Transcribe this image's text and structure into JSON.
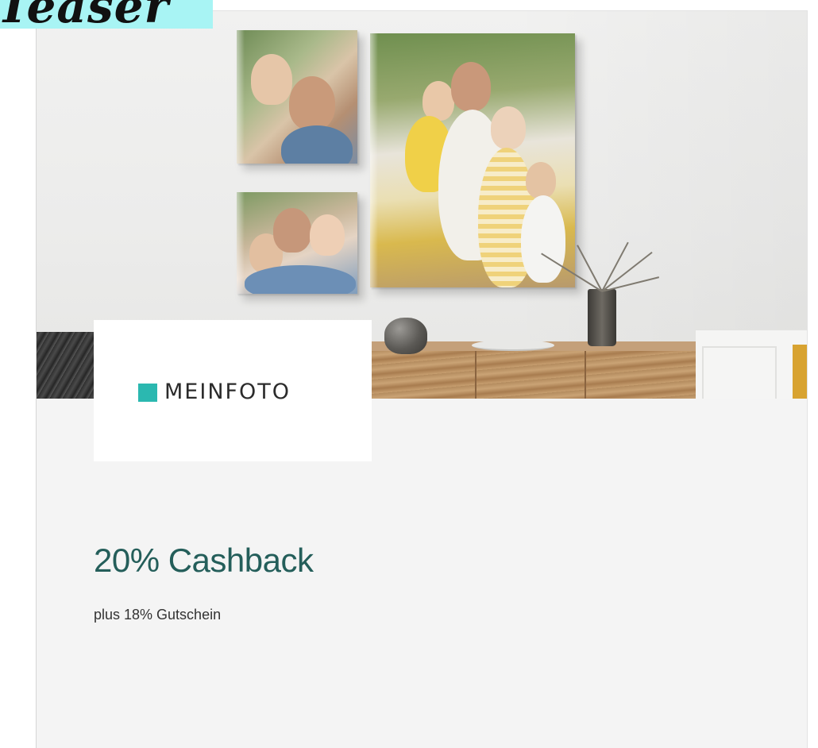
{
  "tag": {
    "label": "Teaser",
    "background": "#a8f4f4"
  },
  "card": {
    "hero": {
      "description_icon": "photo-canvas-scene",
      "colors": {
        "wood": "#c4a07a",
        "chair": "#d8a331"
      }
    },
    "logo": {
      "brand": "MEINFOTO",
      "icon": "teal-square-icon",
      "accent_color": "#2bb8b0"
    },
    "offer": {
      "headline": "20% Cashback",
      "headline_color": "#245e5a",
      "subline": "plus 18% Gutschein"
    }
  }
}
